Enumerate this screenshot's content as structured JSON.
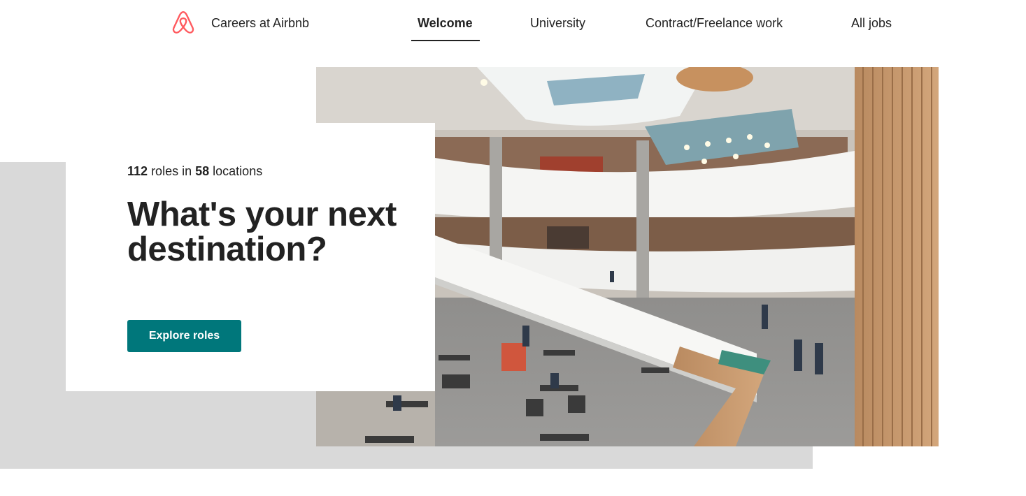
{
  "header": {
    "logo_icon": "airbnb-belo-icon",
    "brand_color": "#FF5A5F",
    "brand_label": "Careers at Airbnb",
    "nav": [
      {
        "label": "Welcome",
        "active": true
      },
      {
        "label": "University",
        "active": false
      },
      {
        "label": "Contract/Freelance work",
        "active": false
      },
      {
        "label": "All jobs",
        "active": false
      }
    ]
  },
  "hero": {
    "roles_count": "112",
    "roles_text": "roles in",
    "locations_count": "58",
    "locations_text": "locations",
    "headline": "What's your next destination?",
    "cta_label": "Explore roles",
    "cta_color": "#00777B",
    "photo_subject": "office-atrium-photo"
  }
}
